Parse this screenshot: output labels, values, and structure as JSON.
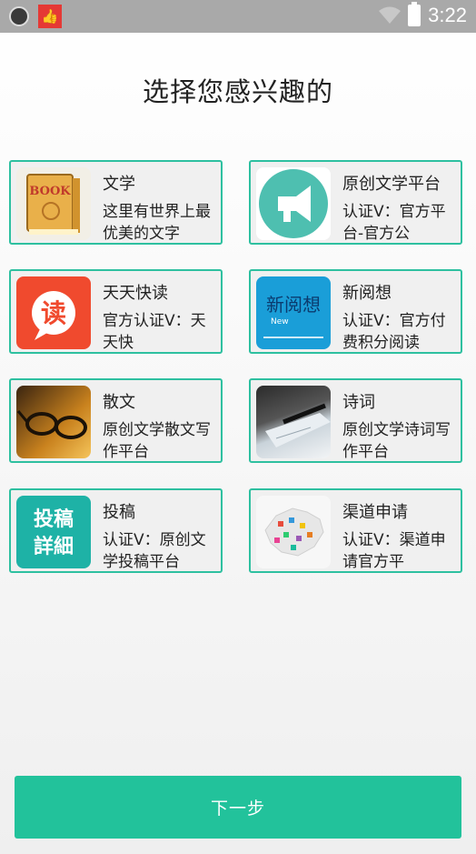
{
  "status_bar": {
    "time": "3:22"
  },
  "page": {
    "title": "选择您感兴趣的"
  },
  "categories": [
    {
      "name": "文学",
      "desc": "这里有世界上最优美的文字",
      "thumb": "book-thumbnail"
    },
    {
      "name": "原创文学平台",
      "desc": "认证V：官方平台-官方公",
      "thumb": "megaphone-icon"
    },
    {
      "name": "天天快读",
      "desc": "官方认证V：天天快",
      "thumb": "read-app-icon"
    },
    {
      "name": "新阅想",
      "desc": "认证V：官方付费积分阅读",
      "thumb": "new-reading-logo"
    },
    {
      "name": "散文",
      "desc": "原创文学散文写作平台",
      "thumb": "glasses-photo"
    },
    {
      "name": "诗词",
      "desc": "原创文学诗词写作平台",
      "thumb": "pen-paper-photo"
    },
    {
      "name": "投稿",
      "desc": "认证V：原创文学投稿平台",
      "thumb": "submission-logo"
    },
    {
      "name": "渠道申请",
      "desc": "认证V：渠道申请官方平",
      "thumb": "china-map-thumbnail"
    }
  ],
  "actions": {
    "next_label": "下一步"
  },
  "thumb_text": {
    "book": "BOOK",
    "read": "读",
    "new_title": "新阅想",
    "new_sub": "New",
    "submit_1": "投稿",
    "submit_2": "詳細"
  },
  "colors": {
    "accent": "#22c29b",
    "card_border": "#2ec0a0"
  }
}
